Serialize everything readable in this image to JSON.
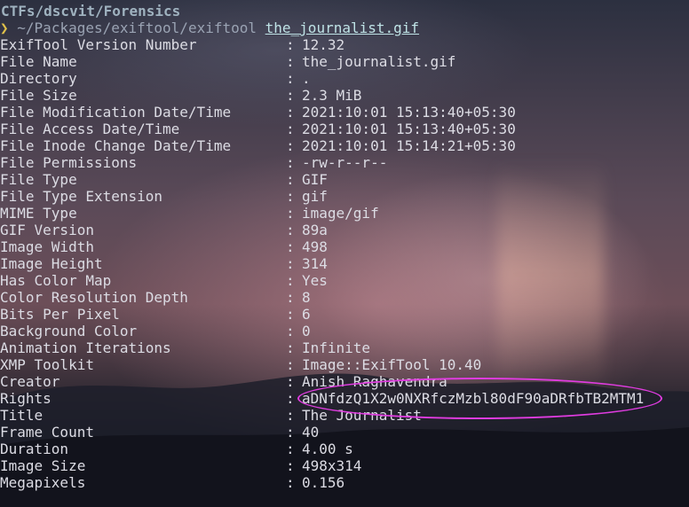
{
  "terminal": {
    "title": "CTFs/dscvit/Forensics",
    "prompt_arrow": "❯",
    "command": "~/Packages/exiftool/exiftool",
    "command_arg": "the_journalist.gif",
    "rows": [
      {
        "key": "ExifTool Version Number",
        "value": "12.32"
      },
      {
        "key": "File Name",
        "value": "the_journalist.gif"
      },
      {
        "key": "Directory",
        "value": "."
      },
      {
        "key": "File Size",
        "value": "2.3 MiB"
      },
      {
        "key": "File Modification Date/Time",
        "value": "2021:10:01 15:13:40+05:30"
      },
      {
        "key": "File Access Date/Time",
        "value": "2021:10:01 15:13:40+05:30"
      },
      {
        "key": "File Inode Change Date/Time",
        "value": "2021:10:01 15:14:21+05:30"
      },
      {
        "key": "File Permissions",
        "value": "-rw-r--r--"
      },
      {
        "key": "File Type",
        "value": "GIF"
      },
      {
        "key": "File Type Extension",
        "value": "gif"
      },
      {
        "key": "MIME Type",
        "value": "image/gif"
      },
      {
        "key": "GIF Version",
        "value": "89a"
      },
      {
        "key": "Image Width",
        "value": "498"
      },
      {
        "key": "Image Height",
        "value": "314"
      },
      {
        "key": "Has Color Map",
        "value": "Yes"
      },
      {
        "key": "Color Resolution Depth",
        "value": "8"
      },
      {
        "key": "Bits Per Pixel",
        "value": "6"
      },
      {
        "key": "Background Color",
        "value": "0"
      },
      {
        "key": "Animation Iterations",
        "value": "Infinite"
      },
      {
        "key": "XMP Toolkit",
        "value": "Image::ExifTool 10.40"
      },
      {
        "key": "Creator",
        "value": "Anish Raghavendra"
      },
      {
        "key": "Rights",
        "value": "aDNfdzQ1X2w0NXRfczMzbl80dF90aDRfbTB2MTM1"
      },
      {
        "key": "Title",
        "value": "The Journalist"
      },
      {
        "key": "Frame Count",
        "value": "40"
      },
      {
        "key": "Duration",
        "value": "4.00 s"
      },
      {
        "key": "Image Size",
        "value": "498x314"
      },
      {
        "key": "Megapixels",
        "value": "0.156"
      }
    ],
    "separator": ":"
  },
  "colors": {
    "highlight_ellipse": "#e03ce0",
    "title": "#9fb2bf",
    "prompt_arrow": "#e0c14a",
    "text": "#dcdce4"
  }
}
